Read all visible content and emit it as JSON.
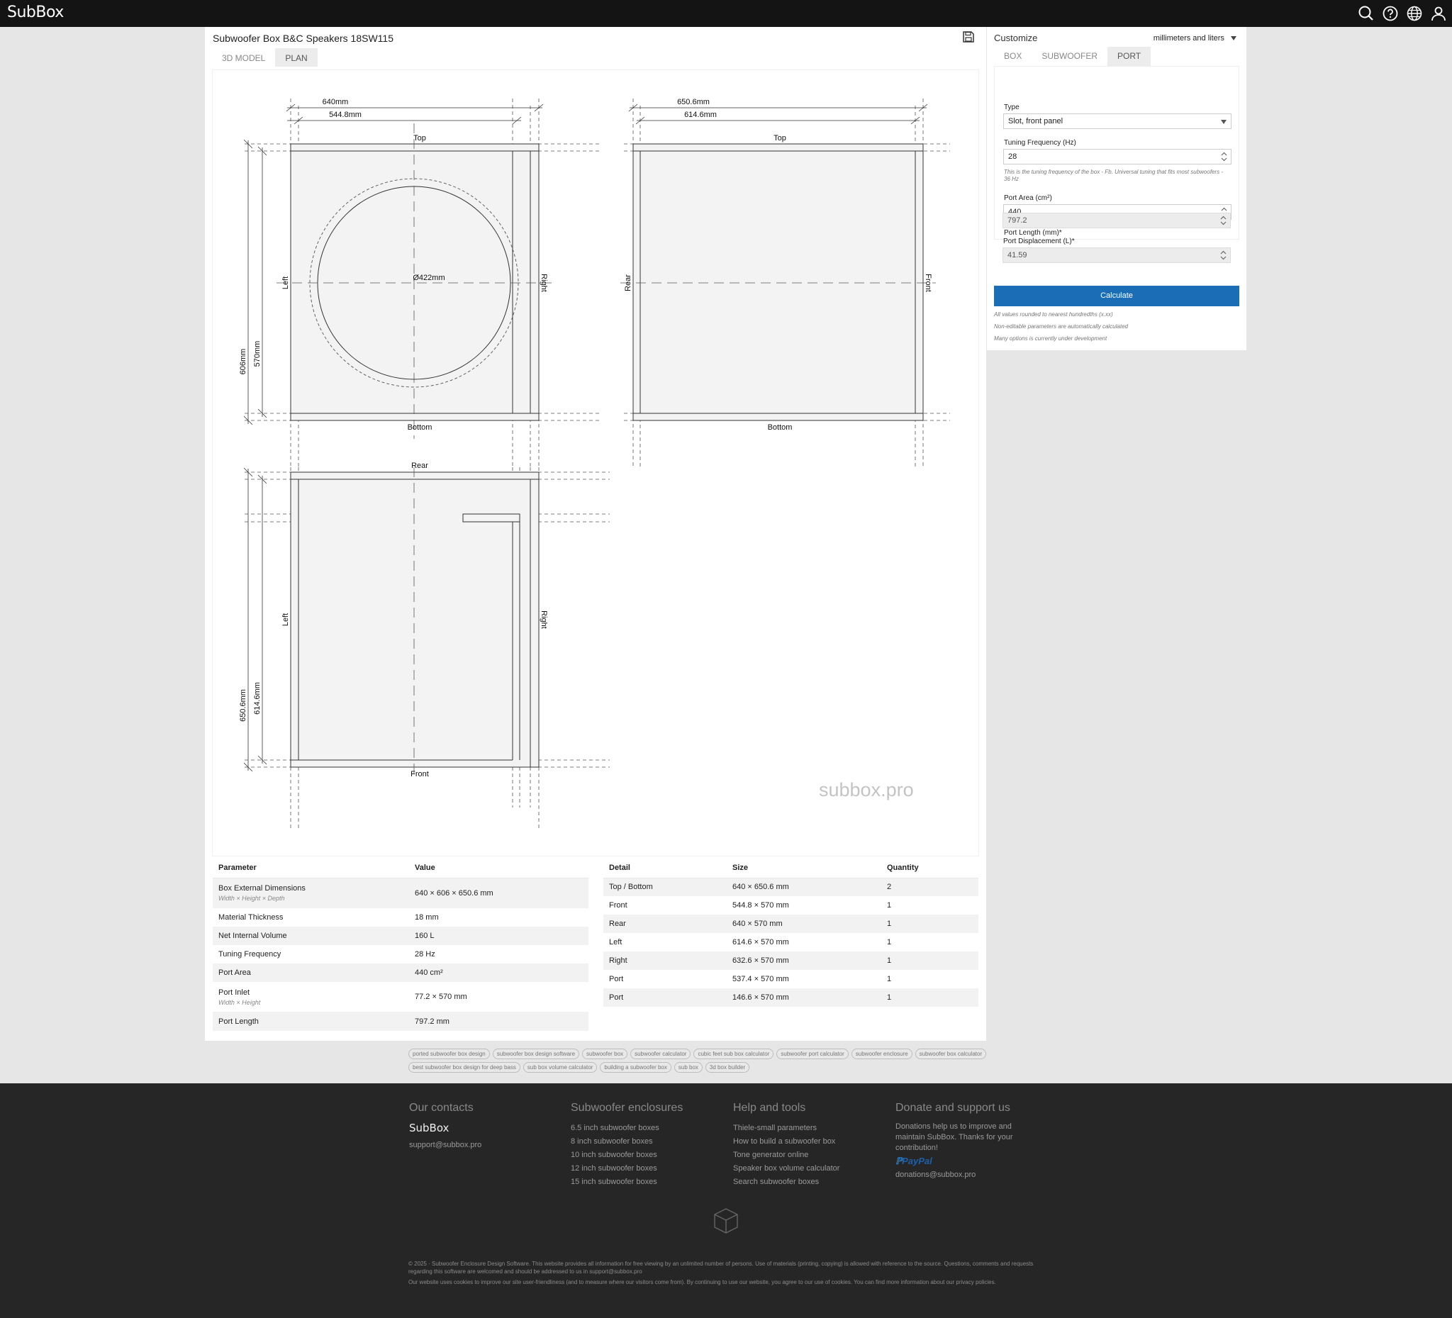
{
  "app": {
    "logo": "SubBox"
  },
  "colors": {
    "topbar": "#141414",
    "accent": "#1b6eb5",
    "footer": "#262626"
  },
  "toolbar_icons": [
    "search-icon",
    "help-icon",
    "globe-icon",
    "user-icon"
  ],
  "main": {
    "title": "Subwoofer Box B&C Speakers 18SW115",
    "tabs": [
      {
        "label": "3D MODEL"
      },
      {
        "label": "PLAN",
        "active": true
      }
    ]
  },
  "plan": {
    "watermark": "subbox.pro",
    "front_view": {
      "width": "640mm",
      "inner_width": "544.8mm",
      "height": "606mm",
      "inner_height": "570mm",
      "cutout": "Ø422mm",
      "top": "Top",
      "bottom": "Bottom",
      "left": "Left",
      "right": "Right"
    },
    "side_view": {
      "width": "650.6mm",
      "inner_width": "614.6mm",
      "top": "Top",
      "bottom": "Bottom",
      "rear": "Rear",
      "front": "Front"
    },
    "top_view": {
      "depth": "650.6mm",
      "inner_depth": "614.6mm",
      "rear": "Rear",
      "front": "Front",
      "left": "Left",
      "right": "Right"
    }
  },
  "params_table": {
    "headers": [
      "Parameter",
      "Value"
    ],
    "rows": [
      {
        "p": "Box External Dimensions",
        "sub": "Width × Height × Depth",
        "v": "640 × 606 × 650.6 mm"
      },
      {
        "p": "Material Thickness",
        "sub": "",
        "v": "18 mm"
      },
      {
        "p": "Net Internal Volume",
        "sub": "",
        "v": "160 L"
      },
      {
        "p": "Tuning Frequency",
        "sub": "",
        "v": "28 Hz"
      },
      {
        "p": "Port Area",
        "sub": "",
        "v": "440 cm²"
      },
      {
        "p": "Port Inlet",
        "sub": "Width × Height",
        "v": "77.2 × 570 mm"
      },
      {
        "p": "Port Length",
        "sub": "",
        "v": "797.2 mm"
      }
    ]
  },
  "details_table": {
    "headers": [
      "Detail",
      "Size",
      "Quantity"
    ],
    "rows": [
      [
        "Top / Bottom",
        "640 × 650.6 mm",
        "2"
      ],
      [
        "Front",
        "544.8 × 570 mm",
        "1"
      ],
      [
        "Rear",
        "640 × 570 mm",
        "1"
      ],
      [
        "Left",
        "614.6 × 570 mm",
        "1"
      ],
      [
        "Right",
        "632.6 × 570 mm",
        "1"
      ],
      [
        "Port",
        "537.4 × 570 mm",
        "1"
      ],
      [
        "Port",
        "146.6 × 570 mm",
        "1"
      ]
    ]
  },
  "customize": {
    "title": "Customize",
    "units": "millimeters and liters",
    "tabs": [
      {
        "label": "BOX"
      },
      {
        "label": "SUBWOOFER"
      },
      {
        "label": "PORT",
        "active": true
      }
    ],
    "type_label": "Type",
    "type_value": "Slot, front panel",
    "tuning_label": "Tuning Frequency (Hz)",
    "tuning_value": "28",
    "tuning_help": "This is the tuning frequency of the box - Fb. Universal tuning that fits most subwoofers - 36 Hz",
    "area_label": "Port Area (cm²)",
    "area_value": "440",
    "length_label": "Port Length (mm)*",
    "length_value": "797.2",
    "disp_label": "Port Displacement (L)*",
    "disp_value": "41.59",
    "calculate": "Calculate",
    "notes": [
      "All values rounded to nearest hundredths (x.xx)",
      "Non-editable parameters are automatically calculated",
      "Many options is currently under development"
    ]
  },
  "tags": [
    "ported subwoofer box design",
    "subwoofer box design software",
    "subwoofer box",
    "subwoofer calculator",
    "cubic feet sub box calculator",
    "subwoofer port calculator",
    "subwoofer enclosure",
    "subwoofer box calculator",
    "best subwoofer box design for deep bass",
    "sub box volume calculator",
    "building a subwoofer box",
    "sub box",
    "3d box builder"
  ],
  "footer": {
    "contacts": {
      "title": "Our contacts",
      "brand": "SubBox",
      "email": "support@subbox.pro"
    },
    "enclosures": {
      "title": "Subwoofer enclosures",
      "links": [
        "6.5 inch subwoofer boxes",
        "8 inch subwoofer boxes",
        "10 inch subwoofer boxes",
        "12 inch subwoofer boxes",
        "15 inch subwoofer boxes"
      ]
    },
    "tools": {
      "title": "Help and tools",
      "links": [
        "Thiele-small parameters",
        "How to build a subwoofer box",
        "Tone generator online",
        "Speaker box volume calculator",
        "Search subwoofer boxes"
      ]
    },
    "donate": {
      "title": "Donate and support us",
      "text": "Donations help us to improve and maintain SubBox. Thanks for your contribution!",
      "paypal": "PayPal",
      "email": "donations@subbox.pro"
    },
    "copyright": "© 2025 · Subwoofer Enclosure Design Software. This website provides all information for free viewing by an unlimited number of persons. Use of materials (printing, copying) is allowed with reference to the source. Questions, comments and requests regarding this software are welcomed and should be addressed to us in support@subbox.pro",
    "cookies": "Our website uses cookies to improve our site user-friendliness (and to measure where our visitors come from). By continuing to use our website, you agree to our use of cookies. You can find more information about our privacy policies."
  }
}
